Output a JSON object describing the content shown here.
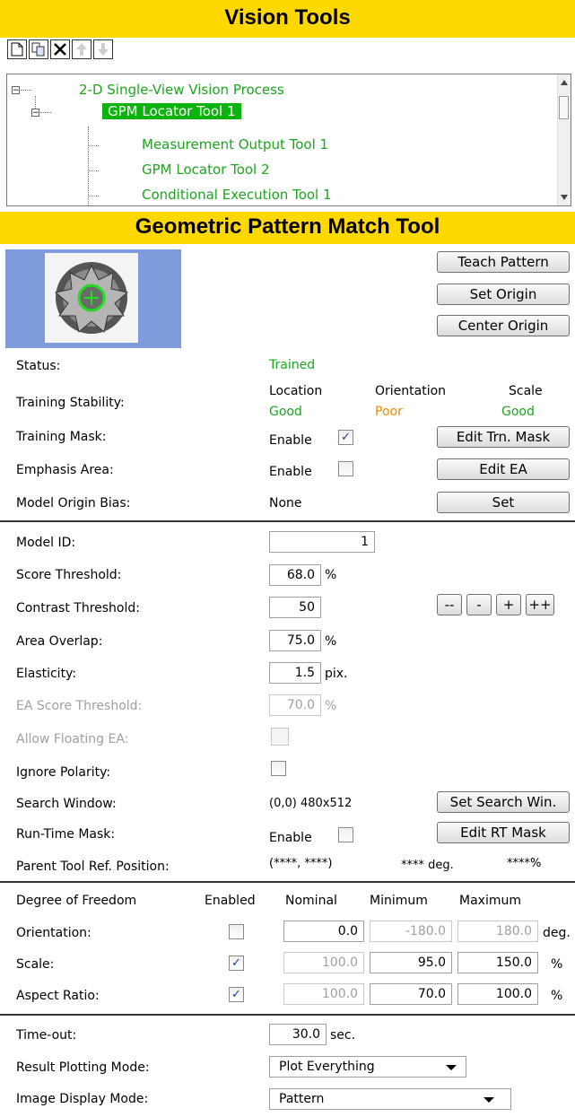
{
  "vision_tools": {
    "title": "Vision Tools",
    "toolbar": [
      "new-icon",
      "copy-icon",
      "delete-icon",
      "move-up-icon",
      "move-down-icon"
    ],
    "tree": [
      {
        "label": "2-D Single-View Vision Process",
        "expander": "⊟",
        "selected": false
      },
      {
        "label": "GPM Locator Tool 1",
        "expander": "⊟",
        "selected": true
      },
      {
        "label": "Measurement Output Tool 1",
        "selected": false
      },
      {
        "label": "GPM Locator Tool 2",
        "selected": false
      },
      {
        "label": "Conditional Execution Tool 1",
        "selected": false
      }
    ]
  },
  "gpm": {
    "title": "Geometric Pattern Match Tool",
    "buttons": {
      "teach_pattern": "Teach Pattern",
      "set_origin": "Set Origin",
      "center_origin": "Center Origin",
      "edit_trn_mask": "Edit Trn. Mask",
      "edit_ea": "Edit EA",
      "set": "Set",
      "dec2": "--",
      "dec1": "-",
      "inc1": "+",
      "inc2": "++",
      "set_search_win": "Set Search Win.",
      "edit_rt_mask": "Edit RT Mask"
    },
    "status": {
      "label": "Status:",
      "value": "Trained"
    },
    "training_stability": {
      "label": "Training Stability:",
      "location": {
        "label": "Location",
        "value": "Good"
      },
      "orientation": {
        "label": "Orientation",
        "value": "Poor"
      },
      "scale": {
        "label": "Scale",
        "value": "Good"
      }
    },
    "training_mask": {
      "label": "Training Mask:",
      "enable_label": "Enable",
      "checked": "✓"
    },
    "emphasis_area": {
      "label": "Emphasis Area:",
      "enable_label": "Enable",
      "checked": ""
    },
    "model_origin_bias": {
      "label": "Model Origin Bias:",
      "value": "None"
    },
    "model_id": {
      "label": "Model ID:",
      "value": "1"
    },
    "score_threshold": {
      "label": "Score Threshold:",
      "value": "68.0",
      "unit": "%"
    },
    "contrast_threshold": {
      "label": "Contrast Threshold:",
      "value": "50"
    },
    "area_overlap": {
      "label": "Area Overlap:",
      "value": "75.0",
      "unit": "%"
    },
    "elasticity": {
      "label": "Elasticity:",
      "value": "1.5",
      "unit": "pix."
    },
    "ea_score_threshold": {
      "label": "EA Score Threshold:",
      "value": "70.0",
      "unit": "%"
    },
    "allow_floating_ea": {
      "label": "Allow Floating EA:"
    },
    "ignore_polarity": {
      "label": "Ignore Polarity:"
    },
    "search_window": {
      "label": "Search Window:",
      "value": "(0,0) 480x512"
    },
    "run_time_mask": {
      "label": "Run-Time Mask:",
      "enable_label": "Enable"
    },
    "parent_ref": {
      "label": "Parent Tool Ref. Position:",
      "position": "(****, ****)",
      "angle": "**** deg.",
      "scale": "****%"
    }
  },
  "dof": {
    "headers": {
      "name": "Degree of Freedom",
      "enabled": "Enabled",
      "nominal": "Nominal",
      "minimum": "Minimum",
      "maximum": "Maximum"
    },
    "rows": [
      {
        "label": "Orientation:",
        "checked": "",
        "nominal": "0.0",
        "minimum": "-180.0",
        "maximum": "180.0",
        "unit": "deg."
      },
      {
        "label": "Scale:",
        "checked": "✓",
        "nominal": "100.0",
        "minimum": "95.0",
        "maximum": "150.0",
        "unit": "%"
      },
      {
        "label": "Aspect Ratio:",
        "checked": "✓",
        "nominal": "100.0",
        "minimum": "70.0",
        "maximum": "100.0",
        "unit": "%"
      }
    ]
  },
  "misc": {
    "timeout": {
      "label": "Time-out:",
      "value": "30.0",
      "unit": "sec."
    },
    "result_plotting": {
      "label": "Result Plotting Mode:",
      "value": "Plot Everything"
    },
    "image_display": {
      "label": "Image Display Mode:",
      "value": "Pattern"
    }
  }
}
